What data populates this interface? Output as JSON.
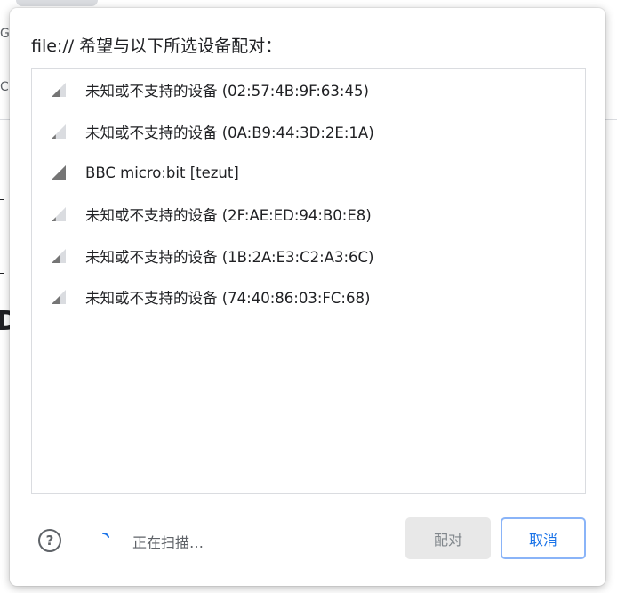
{
  "background": {
    "glyph_1": "G",
    "glyph_2": "C",
    "glyph_3": "D"
  },
  "dialog": {
    "title": "file:// 希望与以下所选设备配对：",
    "devices": [
      {
        "label": "未知或不支持的设备 (02:57:4B:9F:63:45)",
        "signal": 0.6
      },
      {
        "label": "未知或不支持的设备 (0A:B9:44:3D:2E:1A)",
        "signal": 0.3
      },
      {
        "label": "BBC micro:bit [tezut]",
        "signal": 1.0
      },
      {
        "label": "未知或不支持的设备 (2F:AE:ED:94:B0:E8)",
        "signal": 0.3
      },
      {
        "label": "未知或不支持的设备 (1B:2A:E3:C2:A3:6C)",
        "signal": 0.6
      },
      {
        "label": "未知或不支持的设备 (74:40:86:03:FC:68)",
        "signal": 0.6
      }
    ],
    "help_icon": "question-circle-icon",
    "help_glyph": "?",
    "status": "正在扫描…",
    "pair_label": "配对",
    "cancel_label": "取消",
    "accent": "#1a73e8"
  }
}
